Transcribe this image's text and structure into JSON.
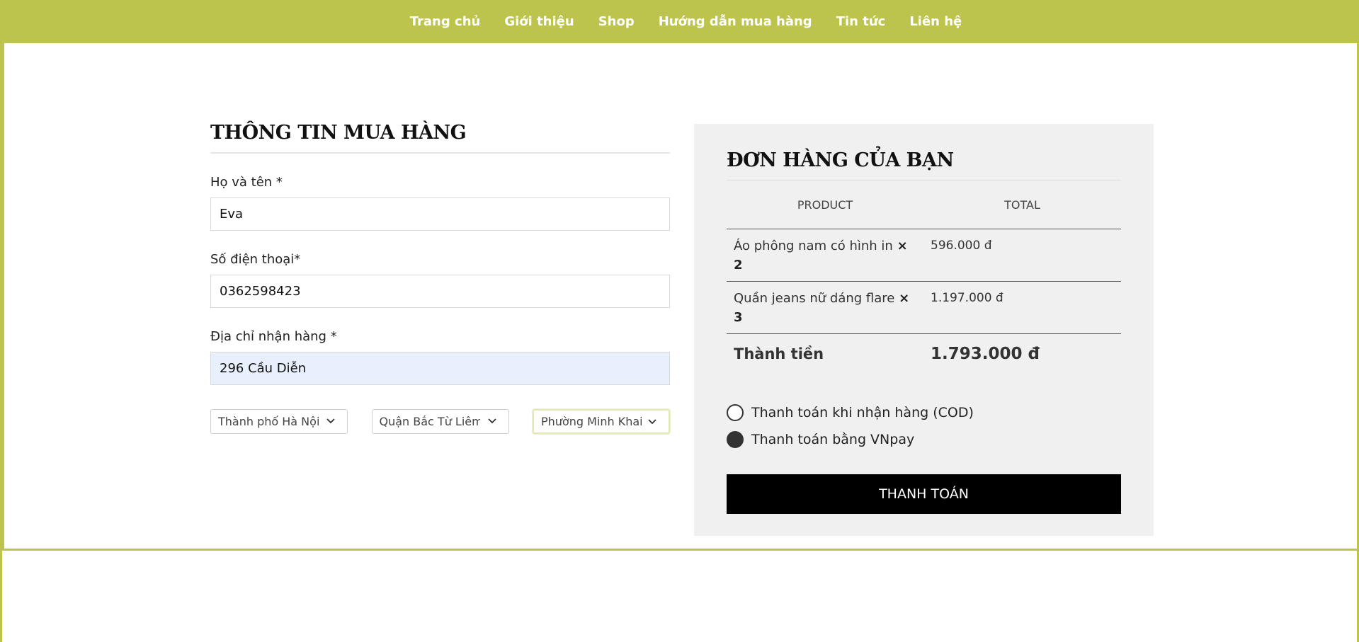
{
  "nav": {
    "items": [
      "Trang chủ",
      "Giới thiệu",
      "Shop",
      "Hướng dẫn mua hàng",
      "Tin tức",
      "Liên hệ"
    ]
  },
  "form": {
    "title": "THÔNG TIN MUA HÀNG",
    "name_label": "Họ và tên *",
    "name_value": "Eva",
    "phone_label": "Số điện thoại*",
    "phone_value": "0362598423",
    "address_label": "Địa chỉ nhận hàng *",
    "address_value": "296 Cầu Diễn",
    "city_value": "Thành phố Hà Nội",
    "district_value": "Quận Bắc Từ Liêm",
    "ward_value": "Phường Minh Khai"
  },
  "order": {
    "title": "ĐƠN HÀNG CỦA BẠN",
    "col_product": "PRODUCT",
    "col_total": "TOTAL",
    "items": [
      {
        "name": "Áo phông nam có hình in",
        "times": "×",
        "qty": "2",
        "total": "596.000 đ"
      },
      {
        "name": "Quần jeans nữ dáng flare",
        "times": "×",
        "qty": "3",
        "total": "1.197.000 đ"
      }
    ],
    "sum_label": "Thành tiền",
    "sum_value": "1.793.000 đ"
  },
  "payment": {
    "options": [
      {
        "label": "Thanh toán khi nhận hàng (COD)",
        "checked": false
      },
      {
        "label": "Thanh toán bằng VNpay",
        "checked": true
      }
    ],
    "submit_label": "THANH TOÁN"
  },
  "colors": {
    "brand": "#bcc44e",
    "panel": "#f0f0f0",
    "button": "#000000"
  }
}
